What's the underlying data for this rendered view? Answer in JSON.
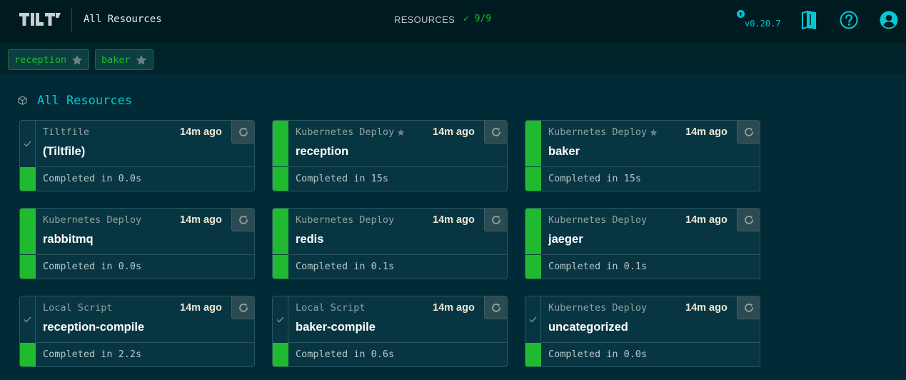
{
  "header": {
    "logo_text": "TILT",
    "page_title": "All Resources",
    "resources_label": "RESOURCES",
    "resources_count": "✓ 9/9",
    "version": "v0.20.7",
    "icons": [
      "update-available-icon",
      "docs-icon",
      "help-icon",
      "account-icon"
    ]
  },
  "pinned": [
    {
      "label": "reception",
      "icon": "star-icon"
    },
    {
      "label": "baker",
      "icon": "star-icon"
    }
  ],
  "section": {
    "title": "All Resources",
    "icon": "cube-icon"
  },
  "cards": [
    {
      "type": "Tiltfile",
      "ago": "14m ago",
      "name": "(Tiltfile)",
      "status": "Completed in 0.0s",
      "pinned": false,
      "runtime": "none"
    },
    {
      "type": "Kubernetes Deploy",
      "ago": "14m ago",
      "name": "reception",
      "status": "Completed in 15s",
      "pinned": true,
      "runtime": "ok"
    },
    {
      "type": "Kubernetes Deploy",
      "ago": "14m ago",
      "name": "baker",
      "status": "Completed in 15s",
      "pinned": true,
      "runtime": "ok"
    },
    {
      "type": "Kubernetes Deploy",
      "ago": "14m ago",
      "name": "rabbitmq",
      "status": "Completed in 0.0s",
      "pinned": false,
      "runtime": "ok"
    },
    {
      "type": "Kubernetes Deploy",
      "ago": "14m ago",
      "name": "redis",
      "status": "Completed in 0.1s",
      "pinned": false,
      "runtime": "ok"
    },
    {
      "type": "Kubernetes Deploy",
      "ago": "14m ago",
      "name": "jaeger",
      "status": "Completed in 0.1s",
      "pinned": false,
      "runtime": "ok"
    },
    {
      "type": "Local Script",
      "ago": "14m ago",
      "name": "reception-compile",
      "status": "Completed in 2.2s",
      "pinned": false,
      "runtime": "none"
    },
    {
      "type": "Local Script",
      "ago": "14m ago",
      "name": "baker-compile",
      "status": "Completed in 0.6s",
      "pinned": false,
      "runtime": "none"
    },
    {
      "type": "Kubernetes Deploy",
      "ago": "14m ago",
      "name": "uncategorized",
      "status": "Completed in 0.0s",
      "pinned": false,
      "runtime": "none"
    }
  ],
  "colors": {
    "background": "#002b36",
    "accent": "#03c7d3",
    "success": "#20ba31",
    "card": "#073642"
  }
}
